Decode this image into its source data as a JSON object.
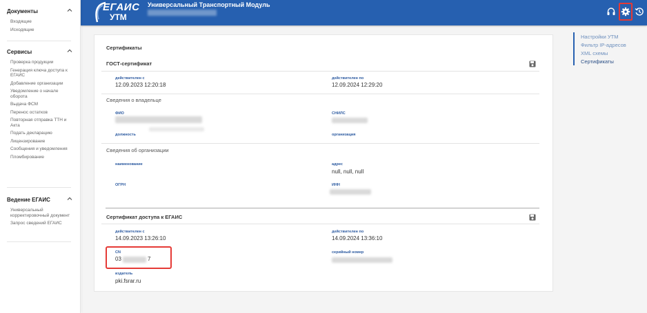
{
  "app": {
    "logo_top": "ЕГАИС",
    "logo_bottom": "УТМ",
    "title": "Универсальный Транспортный Модуль"
  },
  "sidebar": {
    "groups": [
      {
        "title": "Документы",
        "items": [
          "Входящие",
          "Исходящие"
        ]
      },
      {
        "title": "Сервисы",
        "items": [
          "Проверка продукции",
          "Генерация ключа доступа к ЕГАИС",
          "Добавление организации",
          "Уведомление о начале оборота",
          "Выдача ФСМ",
          "Перенос остатков",
          "Повторная отправка ТТН и Акта",
          "Подать декларацию",
          "Лицензирование",
          "Сообщения и уведомления",
          "Пломбирование"
        ]
      },
      {
        "title": "Ведение ЕГАИС",
        "items": [
          "Универсальный корректировочный документ",
          "Запрос сведений ЕГАИС"
        ]
      }
    ]
  },
  "card": {
    "title": "Сертификаты",
    "gost": {
      "title": "ГОСТ-сертификат",
      "valid_from_label": "действителен с",
      "valid_from": "12.09.2023 12:20:18",
      "valid_to_label": "действителен по",
      "valid_to": "12.09.2024 12:29:20",
      "owner_section": "Сведения о владельце",
      "fio_label": "ФИО",
      "snils_label": "СНИЛС",
      "position_label": "должность",
      "org_label": "организация",
      "org_section": "Сведения об организации",
      "name_label": "наименование",
      "address_label": "адрес",
      "address": "null, null, null",
      "ogrn_label": "ОГРН",
      "inn_label": "ИНН"
    },
    "access": {
      "title": "Сертификат доступа к ЕГАИС",
      "valid_from_label": "действителен с",
      "valid_from": "14.09.2023 13:26:10",
      "valid_to_label": "действителен по",
      "valid_to": "14.09.2024 13:36:10",
      "cn_label": "CN",
      "cn_prefix": "03",
      "cn_suffix": "7",
      "serial_label": "серийный номер",
      "issuer_label": "издатель",
      "issuer": "pki.fsrar.ru"
    }
  },
  "right_nav": {
    "items": [
      "Настройки УТМ",
      "Фильтр IP-адресов",
      "XML схемы",
      "Сертификаты"
    ]
  },
  "icons": [
    "headset-icon",
    "gear-icon",
    "history-icon",
    "save-icon",
    "chevron-up-icon"
  ],
  "colors": {
    "header": "#2660b0",
    "highlight": "#e53935",
    "field_label": "#2c5aa0"
  }
}
